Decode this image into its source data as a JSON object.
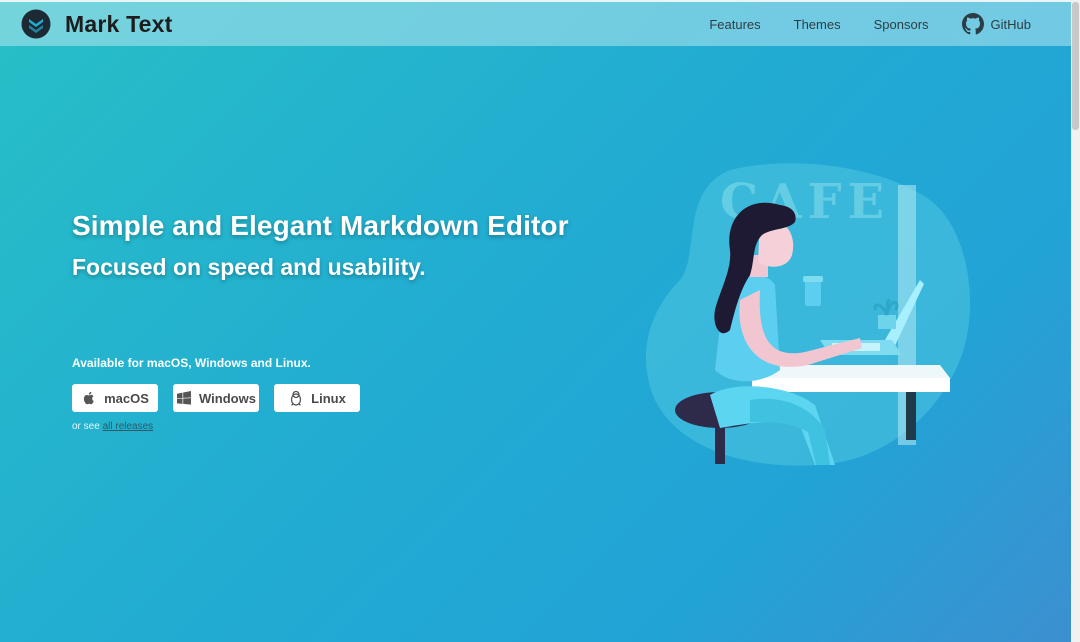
{
  "nav": {
    "brand": "Mark Text",
    "links": [
      "Features",
      "Themes",
      "Sponsors",
      "GitHub"
    ]
  },
  "hero": {
    "title": "Simple and Elegant Markdown Editor",
    "subtitle": "Focused on speed and usability.",
    "available": "Available for macOS, Windows and Linux.",
    "buttons": {
      "macos": "macOS",
      "windows": "Windows",
      "linux": "Linux"
    },
    "see_prefix": "or see ",
    "see_link": "all releases"
  },
  "illustration": {
    "sign": "CAFE"
  },
  "colors": {
    "accent": "#22acd2",
    "nav_text": "#2c3e45",
    "brand_text": "#1d1d1d"
  }
}
